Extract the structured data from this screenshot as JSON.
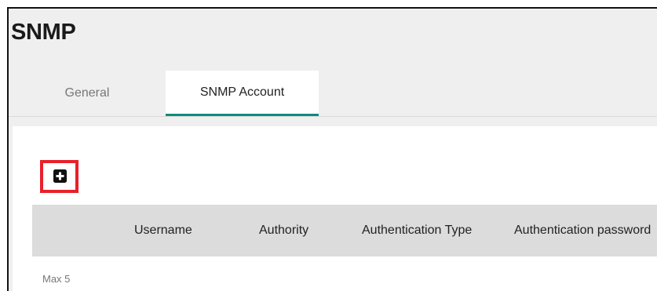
{
  "page": {
    "title": "SNMP"
  },
  "tabs": [
    {
      "label": "General",
      "active": false
    },
    {
      "label": "SNMP Account",
      "active": true
    }
  ],
  "toolbar": {
    "add_icon": "add-square-icon"
  },
  "table": {
    "columns": [
      "Username",
      "Authority",
      "Authentication Type",
      "Authentication password"
    ],
    "rows": []
  },
  "footer": {
    "max_text": "Max 5"
  },
  "colors": {
    "accent": "#0f8a7e",
    "highlight": "#e8202a",
    "header_bg": "#dcdcdc"
  }
}
